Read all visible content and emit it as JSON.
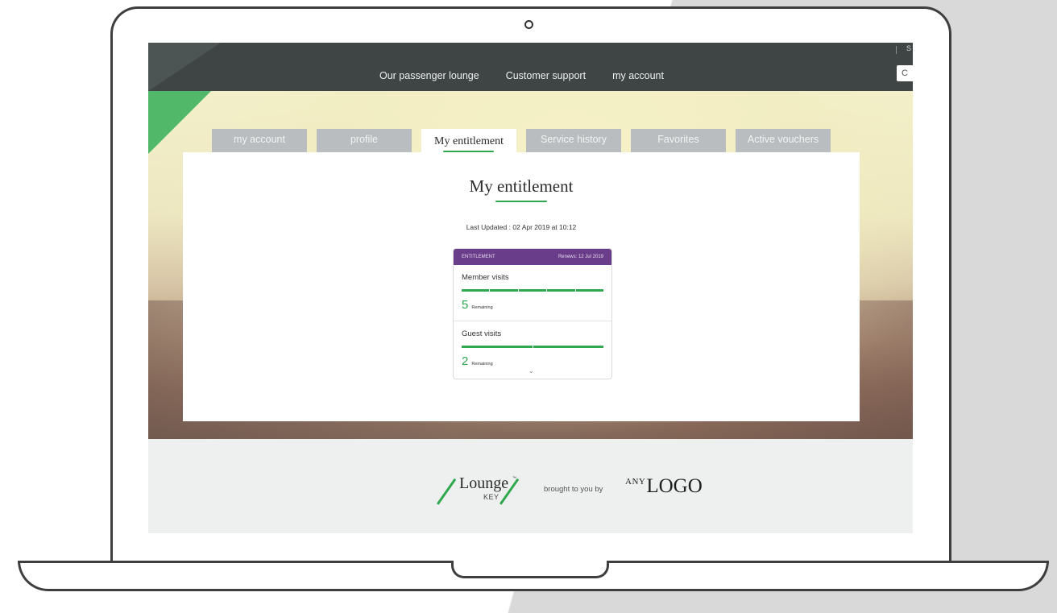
{
  "nav": {
    "links": [
      "Our passenger lounge",
      "Customer support",
      "my account"
    ],
    "top_right_link": "S",
    "search_placeholder": "C"
  },
  "tabs": [
    "my account",
    "profile",
    "My entitlement",
    "Service history",
    "Favorites",
    "Active vouchers"
  ],
  "active_tab": "My entitlement",
  "panel": {
    "title": "My entitlement",
    "last_updated_label": "Last Updated :",
    "last_updated_value": "02 Apr 2019 at 10:12"
  },
  "card": {
    "header_left": "ENTITLEMENT",
    "header_right": "Renews: 12 Jul 2019",
    "member": {
      "label": "Member visits",
      "total_segments": 5,
      "remaining": "5",
      "remaining_label": "Remaining"
    },
    "guest": {
      "label": "Guest visits",
      "total_segments": 2,
      "remaining": "2",
      "remaining_label": "Remaining"
    }
  },
  "footer": {
    "brand_name": "Lounge",
    "brand_tm": "™",
    "brand_sub": "KEY",
    "brought_text": "brought to you by",
    "partner_small": "ANY",
    "partner_big": "LOGO"
  },
  "colors": {
    "accent_green": "#2fa84f",
    "card_header_purple": "#6a3d8a",
    "topbar": "#3f4545",
    "tab_inactive": "#b9bdbf"
  },
  "icons": {
    "expand": "chevron-down-icon"
  }
}
